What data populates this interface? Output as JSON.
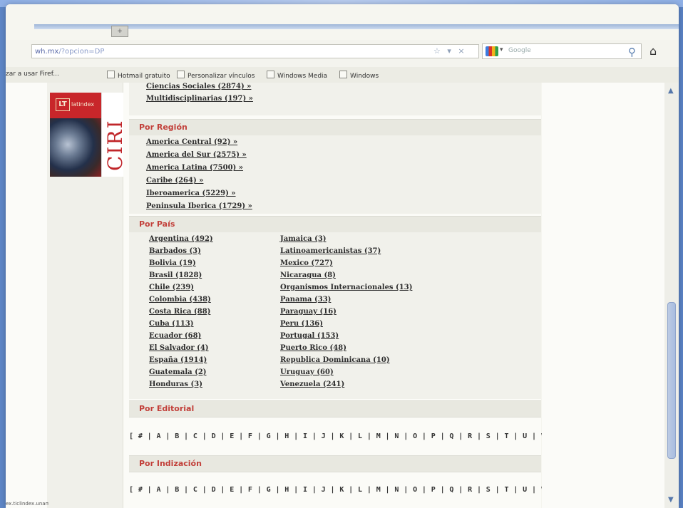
{
  "browser": {
    "url": "wh.mx/?opcion=DP",
    "url_host": "wh.mx",
    "url_tail": "/?opcion=DP",
    "url_icons": "☆ ▾ ×",
    "search_placeholder": "Google",
    "bookmarks": [
      "zar a usar Firef...",
      "Hotmail gratuito",
      "Personalizar vínculos",
      "Windows Media",
      "Windows"
    ],
    "status_text": "ex.ticlindex.unam.mx"
  },
  "sidebar": {
    "logo_word": "latindex",
    "logo_mark": "LT",
    "logo_side_text": "CIRI"
  },
  "top_links": [
    "Ciencias Sociales (2874) »",
    "Multidisciplinarias (197) »"
  ],
  "sections": {
    "region": {
      "title": "Por Región",
      "links": [
        "America Central (92) »",
        "America del Sur (2575) »",
        "America Latina (7500) »",
        "Caribe (264) »",
        "Iberoamerica (5229) »",
        "Peninsula Iberica (1729) »"
      ]
    },
    "pais": {
      "title": "Por País",
      "col1": [
        "Argentina (492)",
        "Barbados (3)",
        "Bolivia (19)",
        "Brasil (1828)",
        "Chile (239)",
        "Colombia (438)",
        "Costa Rica (88)",
        "Cuba (113)",
        "Ecuador (68)",
        "El Salvador (4)",
        "España (1914)",
        "Guatemala (2)",
        "Honduras (3)"
      ],
      "col2": [
        "Jamaica (3)",
        "Latinoamericanistas (37)",
        "Mexico (727)",
        "Nicaragua (8)",
        "Organismos Internacionales (13)",
        "Panama (33)",
        "Paraguay (16)",
        "Peru (136)",
        "Portugal (153)",
        "Puerto Rico (48)",
        "Republica Dominicana (10)",
        "Uruguay (60)",
        "Venezuela (241)"
      ]
    },
    "editorial": {
      "title": "Por Editorial",
      "alpha": "[ # | A | B | C | D | E | F | G | H | I | J | K | L | M | N | O | P | Q | R | S | T | U | V | W | X | Y | Z ]"
    },
    "indizacion": {
      "title": "Por Indización",
      "alpha": "[ # | A | B | C | D | E | F | G | H | I | J | K | L | M | N | O | P | Q | R | S | T | U | V | W | X | Y | Z ]"
    }
  },
  "colors": {
    "section_title": "#c2403a",
    "page_bg": "#fbfbf7",
    "backdrop": "#6f93d2"
  }
}
